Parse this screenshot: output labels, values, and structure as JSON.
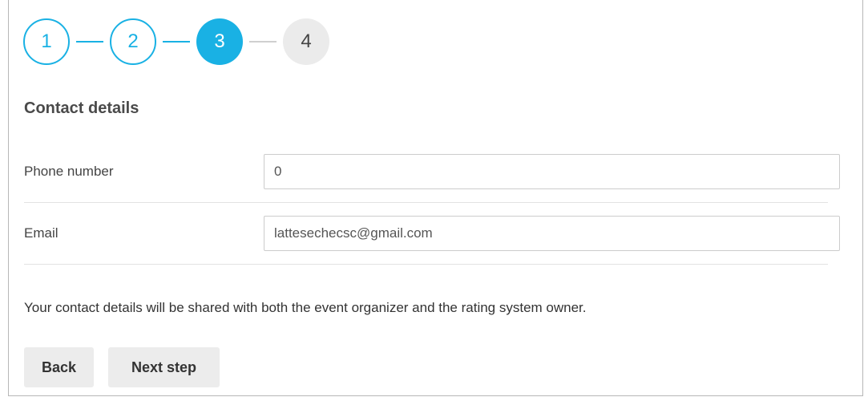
{
  "stepper": {
    "steps": [
      {
        "label": "1",
        "state": "done"
      },
      {
        "label": "2",
        "state": "done"
      },
      {
        "label": "3",
        "state": "active"
      },
      {
        "label": "4",
        "state": "pending"
      }
    ]
  },
  "form": {
    "title": "Contact details",
    "phone": {
      "label": "Phone number",
      "value": "0"
    },
    "email": {
      "label": "Email",
      "value": "lattesechecsc@gmail.com"
    },
    "notice": "Your contact details will be shared with both the event organizer and the rating system owner."
  },
  "actions": {
    "back_label": "Back",
    "next_label": "Next step"
  },
  "colors": {
    "accent": "#19b1e4",
    "button_bg": "#ececec"
  }
}
